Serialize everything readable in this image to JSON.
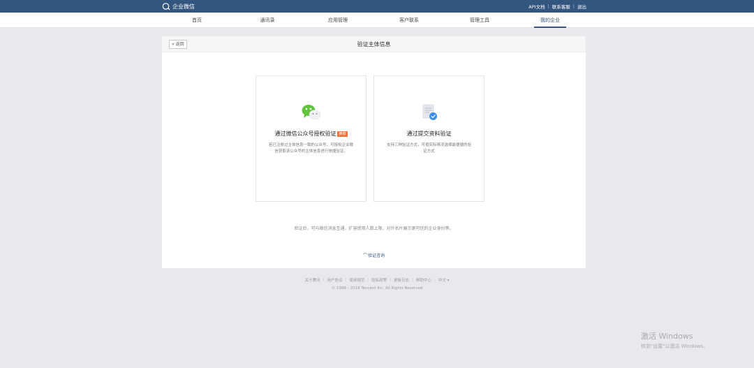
{
  "topbar": {
    "brand": "企业微信",
    "links": [
      "API文档",
      "联系客服",
      "退出"
    ]
  },
  "nav": {
    "items": [
      "首页",
      "通讯录",
      "应用管理",
      "客户联系",
      "管理工具",
      "我的企业"
    ],
    "active": "我的企业"
  },
  "page": {
    "back_label": "« 返回",
    "title": "验证主体信息"
  },
  "cards": [
    {
      "title": "通过微信公众号授权验证",
      "badge": "推荐",
      "desc": "若已注册过主体信息一致的公众号，可授权企业微信获取该公众号的主体信息进行快捷验证。"
    },
    {
      "title": "通过提交资料验证",
      "desc": "支持三种验证方式，可按实际情况选择最便捷的验证方式"
    }
  ],
  "note": "验证后，可与微信消息互通，扩容使用人数上限，对外名片展示更可信的企业身份等。",
  "help_link": "验证咨询",
  "footer": {
    "links": [
      "关于腾讯",
      "用户协议",
      "使用规范",
      "隐私政策",
      "更新日志",
      "帮助中心",
      "中文 ▾"
    ],
    "copyright": "© 1998 - 2019 Tencent Inc. All Rights Reserved"
  },
  "watermark": {
    "line1": "激活 Windows",
    "line2": "转到\"设置\"以激活 Windows。"
  },
  "colors": {
    "topbar": "#33567f",
    "accent": "#33567f",
    "badge": "#f2733d",
    "wechat_green": "#61c43b"
  }
}
